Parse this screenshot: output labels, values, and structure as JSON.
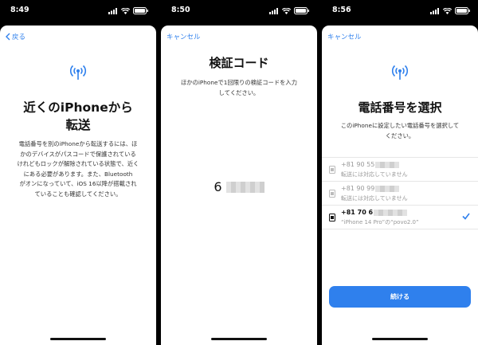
{
  "screens": [
    {
      "time": "8:49",
      "back_label": "戻る",
      "title_lines": [
        "近くのiPhoneから",
        "転送"
      ],
      "body_lines": [
        "電話番号を別のiPhoneから転送するには、ほ",
        "かのデバイスがパスコードで保護されている",
        "けれどもロックが解除されている状態で、近く",
        "にある必要があります。また、Bluetooth",
        "がオンになっていて、iOS 16以降が搭載され",
        "ていることも確認してください。"
      ]
    },
    {
      "time": "8:50",
      "cancel_label": "キャンセル",
      "title": "検証コード",
      "body_lines": [
        "ほかのiPhoneで1回限りの検証コードを入力",
        "してください。"
      ],
      "code_prefix": "6"
    },
    {
      "time": "8:56",
      "cancel_label": "キャンセル",
      "title": "電話番号を選択",
      "body_lines": [
        "このiPhoneに設定したい電話番号を選択して",
        "ください。"
      ],
      "numbers": [
        {
          "number": "+81 90 55",
          "sub": "転送には対応していません",
          "selected": false
        },
        {
          "number": "+81 90 99",
          "sub": "転送には対応していません",
          "selected": false
        },
        {
          "number": "+81 70 6",
          "sub": "“iPhone 14 Pro”の“povo2.0”",
          "selected": true
        }
      ],
      "continue_label": "続ける"
    }
  ]
}
